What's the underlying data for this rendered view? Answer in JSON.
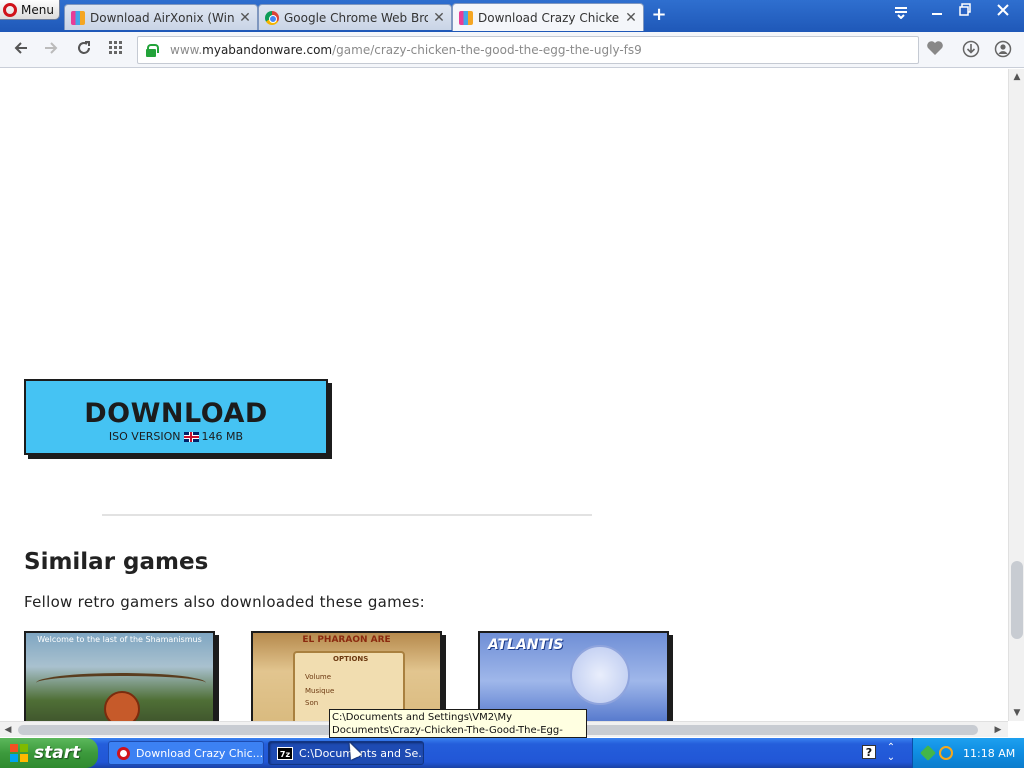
{
  "browser": {
    "menu_label": "Menu",
    "tabs": [
      {
        "title": "Download AirXonix (Windows",
        "favicon": "myabandonware-icon"
      },
      {
        "title": "Google Chrome Web Browser",
        "favicon": "chrome-icon"
      },
      {
        "title": "Download Crazy Chicken: Th",
        "favicon": "myabandonware-icon",
        "active": true
      }
    ],
    "new_tab_symbol": "+",
    "url": {
      "prefix": "www.",
      "host": "myabandonware.com",
      "path": "/game/crazy-chicken-the-good-the-egg-the-ugly-fs9"
    }
  },
  "page": {
    "download": {
      "title": "DOWNLOAD",
      "version": "ISO VERSION",
      "size": "146 MB",
      "language_flag": "uk-flag-icon",
      "color": "#45c3f3"
    },
    "similar": {
      "heading": "Similar games",
      "subtitle": "Fellow retro gamers also downloaded these games:",
      "games": [
        {
          "caption": "Welcome to the last of the Shamanismus"
        },
        {
          "caption": "EL PHARAON ARE",
          "menu": [
            "OPTIONS",
            "Volume",
            "Musique",
            "Son"
          ]
        },
        {
          "caption": "ATLANTIS"
        }
      ]
    }
  },
  "tooltip": {
    "line1": "C:\\Documents and Settings\\VM2\\My",
    "line2": "Documents\\Crazy-Chicken-The-Good-The-Egg-The-U"
  },
  "taskbar": {
    "start_label": "start",
    "tasks": [
      {
        "label": "Download Crazy Chic...",
        "icon": "opera-icon"
      },
      {
        "label": "C:\\Documents and Se...",
        "icon": "7zip-icon",
        "active": true
      }
    ],
    "help_symbol": "?",
    "clock": "11:18 AM"
  }
}
